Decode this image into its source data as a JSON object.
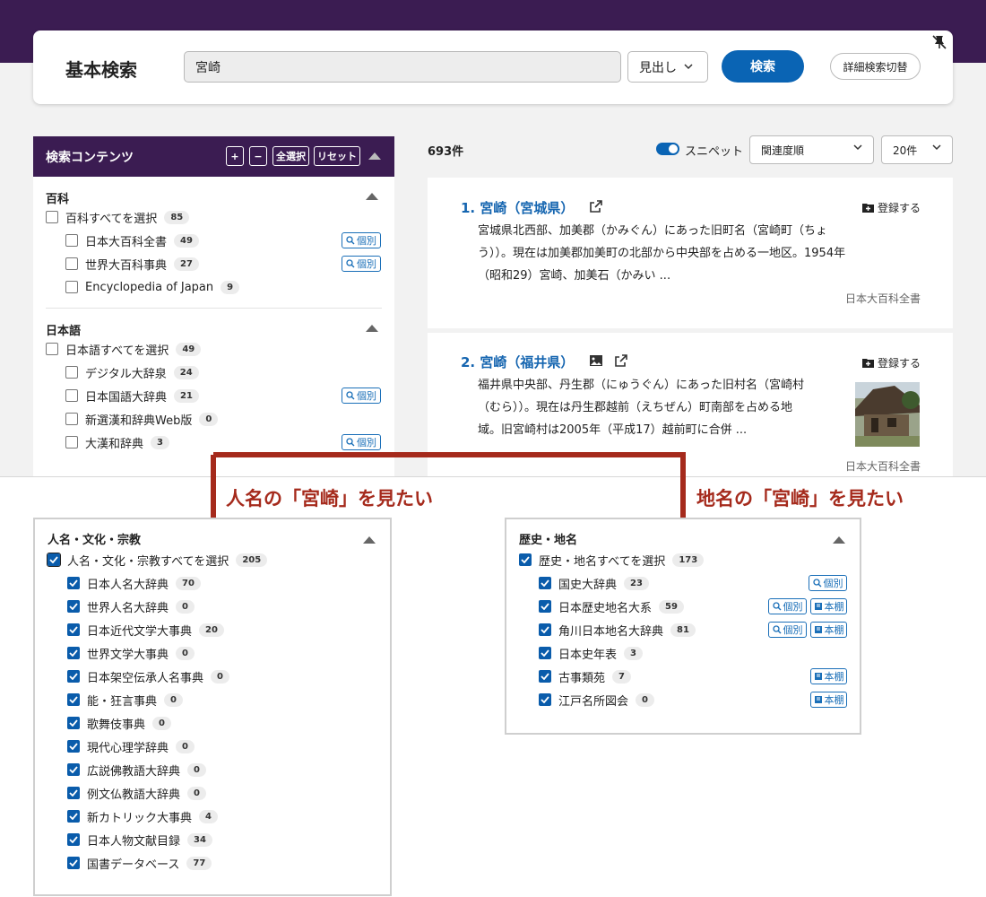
{
  "header": {
    "title": "基本検索",
    "search_value": "宮崎",
    "mode": "見出し",
    "search_label": "検索",
    "advanced_label": "詳細検索切替"
  },
  "sidebar": {
    "title": "検索コンテンツ",
    "plus": "+",
    "minus": "−",
    "select_all": "全選択",
    "reset": "リセット",
    "sections": [
      {
        "title": "百科",
        "all_label": "百科すべてを選択",
        "all_count": "85",
        "items": [
          {
            "label": "日本大百科全書",
            "count": "49",
            "tag": "個別"
          },
          {
            "label": "世界大百科事典",
            "count": "27",
            "tag": "個別"
          },
          {
            "label": "Encyclopedia of Japan",
            "count": "9",
            "tag": ""
          }
        ]
      },
      {
        "title": "日本語",
        "all_label": "日本語すべてを選択",
        "all_count": "49",
        "items": [
          {
            "label": "デジタル大辞泉",
            "count": "24",
            "tag": ""
          },
          {
            "label": "日本国語大辞典",
            "count": "21",
            "tag": "個別"
          },
          {
            "label": "新選漢和辞典Web版",
            "count": "0",
            "tag": ""
          },
          {
            "label": "大漢和辞典",
            "count": "3",
            "tag": "個別"
          }
        ]
      }
    ]
  },
  "results": {
    "count": "693件",
    "snippet_label": "スニペット",
    "sort": "関連度順",
    "per_page": "20件",
    "save_label": "登録する",
    "items": [
      {
        "title": "1. 宮崎（宮城県）",
        "lines": [
          "宮城県北西部、加美郡（かみぐん）にあった旧町名（宮崎町（ちょ",
          "う））。現在は加美郡加美町の北部から中央部を占める一地区。1954年",
          "（昭和29）宮崎、加美石（かみい ..."
        ],
        "source": "日本大百科全書"
      },
      {
        "title": "2. 宮崎（福井県）",
        "lines": [
          "福井県中央部、丹生郡（にゅうぐん）にあった旧村名（宮崎村",
          "（むら））。現在は丹生郡越前（えちぜん）町南部を占める地",
          "域。旧宮崎村は2005年（平成17）越前町に合併 ..."
        ],
        "source": "日本大百科全書"
      }
    ]
  },
  "annotations": {
    "left": "人名の「宮崎」を見たい",
    "right": "地名の「宮崎」を見たい"
  },
  "panel_people": {
    "title": "人名・文化・宗教",
    "all_label": "人名・文化・宗教すべてを選択",
    "all_count": "205",
    "items": [
      {
        "label": "日本人名大辞典",
        "count": "70"
      },
      {
        "label": "世界人名大辞典",
        "count": "0"
      },
      {
        "label": "日本近代文学大事典",
        "count": "20"
      },
      {
        "label": "世界文学大事典",
        "count": "0"
      },
      {
        "label": "日本架空伝承人名事典",
        "count": "0"
      },
      {
        "label": "能・狂言事典",
        "count": "0"
      },
      {
        "label": "歌舞伎事典",
        "count": "0"
      },
      {
        "label": "現代心理学辞典",
        "count": "0"
      },
      {
        "label": "広説佛教語大辞典",
        "count": "0"
      },
      {
        "label": "例文仏教語大辞典",
        "count": "0"
      },
      {
        "label": "新カトリック大事典",
        "count": "4"
      },
      {
        "label": "日本人物文献目録",
        "count": "34"
      },
      {
        "label": "国書データベース",
        "count": "77"
      }
    ]
  },
  "panel_places": {
    "title": "歴史・地名",
    "all_label": "歴史・地名すべてを選択",
    "all_count": "173",
    "items": [
      {
        "label": "国史大辞典",
        "count": "23",
        "tags": [
          "個別"
        ]
      },
      {
        "label": "日本歴史地名大系",
        "count": "59",
        "tags": [
          "個別",
          "本棚"
        ]
      },
      {
        "label": "角川日本地名大辞典",
        "count": "81",
        "tags": [
          "個別",
          "本棚"
        ]
      },
      {
        "label": "日本史年表",
        "count": "3",
        "tags": []
      },
      {
        "label": "古事類苑",
        "count": "7",
        "tags": [
          "本棚"
        ]
      },
      {
        "label": "江戸名所図会",
        "count": "0",
        "tags": [
          "本棚"
        ]
      }
    ]
  }
}
